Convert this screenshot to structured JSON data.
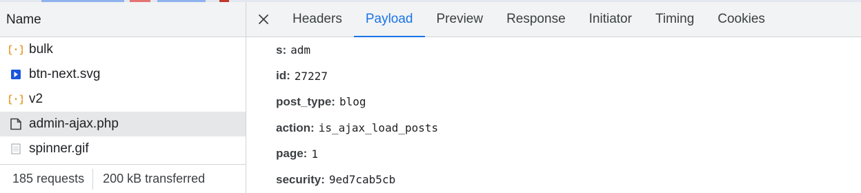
{
  "colors": {
    "accent": "#1a73e8",
    "json_icon": "#e8a33a",
    "svg_icon": "#1a56db",
    "selected_row": "#e6e7e8",
    "header_bg": "#f1f3f4"
  },
  "request_list": {
    "header": "Name",
    "rows": [
      {
        "name": "bulk",
        "icon": "json-braces-icon"
      },
      {
        "name": "btn-next.svg",
        "icon": "svg-image-icon"
      },
      {
        "name": "v2",
        "icon": "json-braces-icon"
      },
      {
        "name": "admin-ajax.php",
        "icon": "document-icon",
        "selected": true
      },
      {
        "name": "spinner.gif",
        "icon": "image-icon"
      }
    ]
  },
  "status_bar": {
    "requests": "185 requests",
    "transferred": "200 kB transferred"
  },
  "details": {
    "close_icon": "close-icon",
    "tabs": [
      "Headers",
      "Payload",
      "Preview",
      "Response",
      "Initiator",
      "Timing",
      "Cookies"
    ],
    "active_tab": "Payload",
    "payload": [
      {
        "key": "s:",
        "value": "adm"
      },
      {
        "key": "id:",
        "value": "27227"
      },
      {
        "key": "post_type:",
        "value": "blog"
      },
      {
        "key": "action:",
        "value": "is_ajax_load_posts"
      },
      {
        "key": "page:",
        "value": "1"
      },
      {
        "key": "security:",
        "value": "9ed7cab5cb"
      }
    ]
  }
}
